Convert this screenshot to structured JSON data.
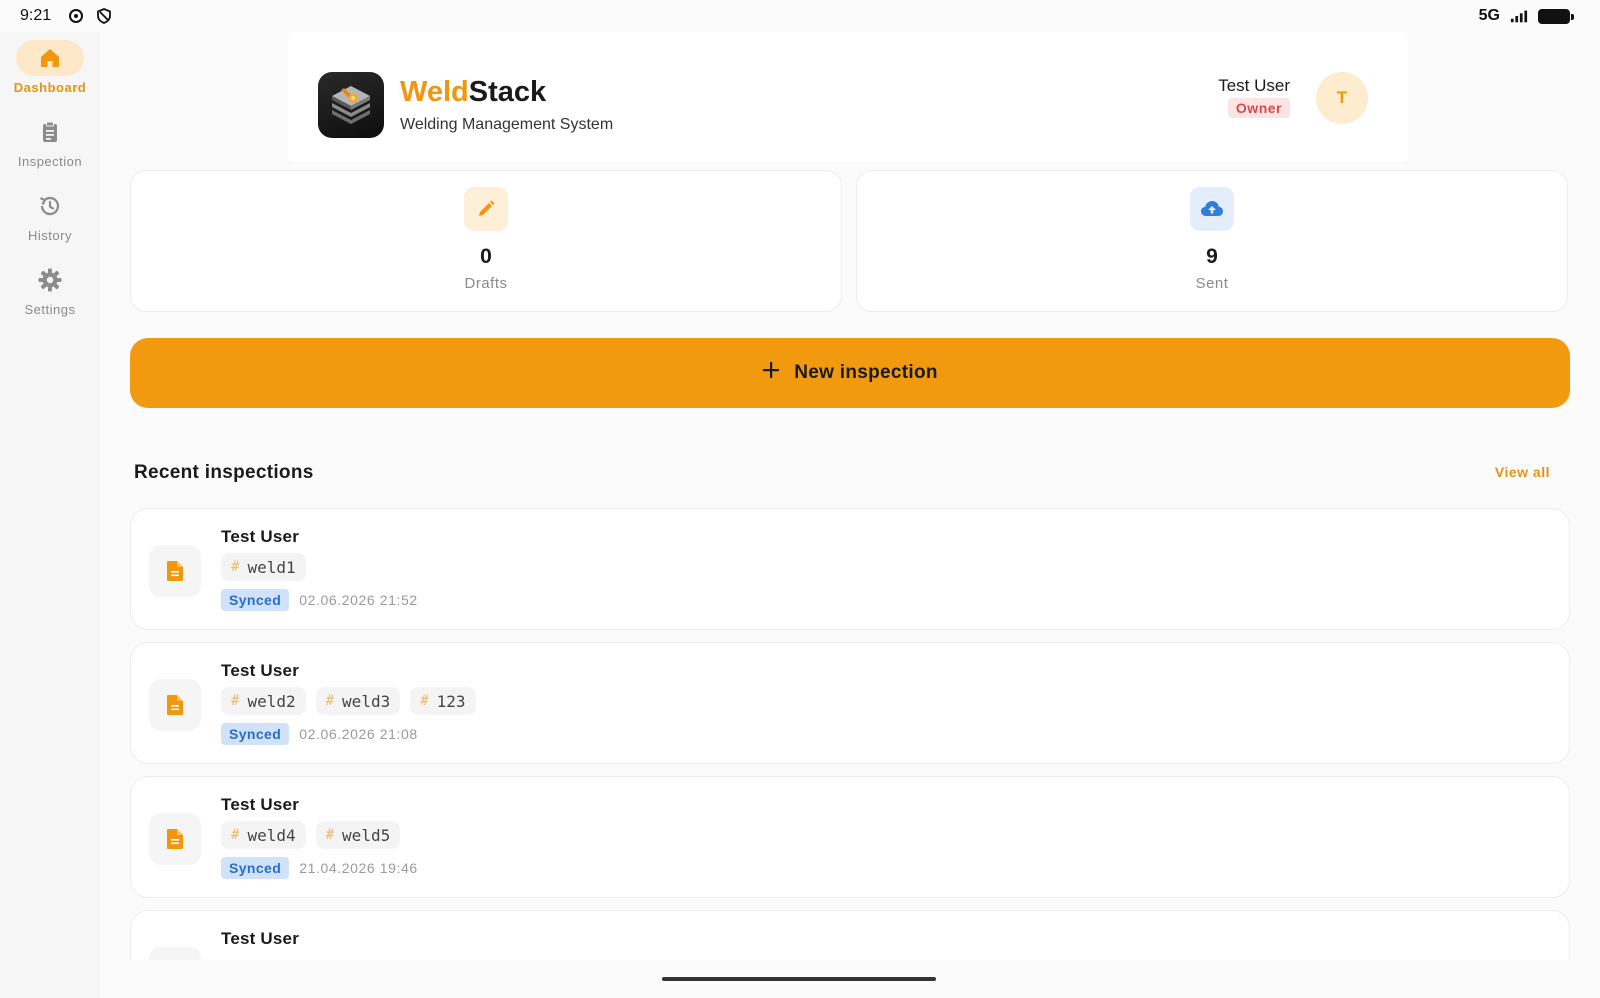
{
  "status_bar": {
    "time": "9:21",
    "network": "5G"
  },
  "sidebar": {
    "items": [
      {
        "label": "Dashboard",
        "icon": "home-icon",
        "active": true
      },
      {
        "label": "Inspection",
        "icon": "clipboard-icon",
        "active": false
      },
      {
        "label": "History",
        "icon": "history-icon",
        "active": false
      },
      {
        "label": "Settings",
        "icon": "gear-icon",
        "active": false
      }
    ]
  },
  "header": {
    "brand_part1": "Weld",
    "brand_part2": "Stack",
    "subtitle": "Welding Management System",
    "user_name": "Test User",
    "role": "Owner",
    "avatar_initial": "T"
  },
  "stats": {
    "drafts": {
      "value": "0",
      "label": "Drafts",
      "icon": "pencil-icon"
    },
    "sent": {
      "value": "9",
      "label": "Sent",
      "icon": "cloud-upload-icon"
    }
  },
  "actions": {
    "new_inspection": "New inspection"
  },
  "recent": {
    "title": "Recent inspections",
    "view_all": "View all",
    "items": [
      {
        "user": "Test User",
        "tags": [
          "weld1"
        ],
        "status": "Synced",
        "date": "02.06.2026 21:52"
      },
      {
        "user": "Test User",
        "tags": [
          "weld2",
          "weld3",
          "123"
        ],
        "status": "Synced",
        "date": "02.06.2026 21:08"
      },
      {
        "user": "Test User",
        "tags": [
          "weld4",
          "weld5"
        ],
        "status": "Synced",
        "date": "21.04.2026 19:46"
      },
      {
        "user": "Test User",
        "tags": [],
        "status": "",
        "date": ""
      }
    ]
  },
  "colors": {
    "accent": "#f29a0f",
    "synced_bg": "#cfe2fa",
    "synced_text": "#2a6cc8",
    "owner_bg": "#fde4e4",
    "owner_text": "#e04848"
  }
}
